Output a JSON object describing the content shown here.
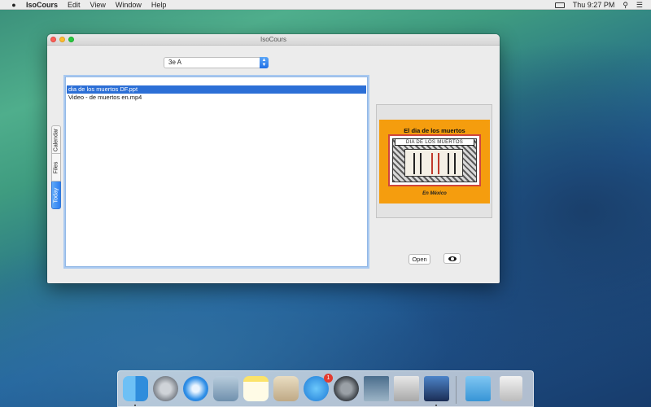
{
  "menubar": {
    "app_name": "IsoCours",
    "menus": [
      "Edit",
      "View",
      "Window",
      "Help"
    ],
    "clock": "Thu 9:27 PM"
  },
  "window": {
    "title": "IsoCours",
    "class_select": {
      "value": "3e A"
    },
    "tabs": [
      {
        "label": "Today",
        "active": true
      },
      {
        "label": "Files",
        "active": false
      },
      {
        "label": "Calendar",
        "active": false
      }
    ],
    "files": [
      {
        "name": "dia de los muertos DF.ppt",
        "selected": true
      },
      {
        "name": "Video - de muertos en.mp4",
        "selected": false
      }
    ],
    "preview": {
      "slide_title": "El dia de los muertos",
      "slide_banner": "DIA DE LOS MUERTOS",
      "slide_subtitle": "En México"
    },
    "open_button": "Open",
    "preview_button_icon": "eye-icon"
  },
  "dock": {
    "items": [
      "finder-icon",
      "launchpad-icon",
      "safari-icon",
      "mail-icon",
      "notes-icon",
      "preview-icon",
      "app-store-icon",
      "system-preferences-icon",
      "photo-icon",
      "photo-icon",
      "imovie-icon",
      "downloads-folder-icon",
      "trash-icon"
    ],
    "app_store_badge": "1"
  }
}
